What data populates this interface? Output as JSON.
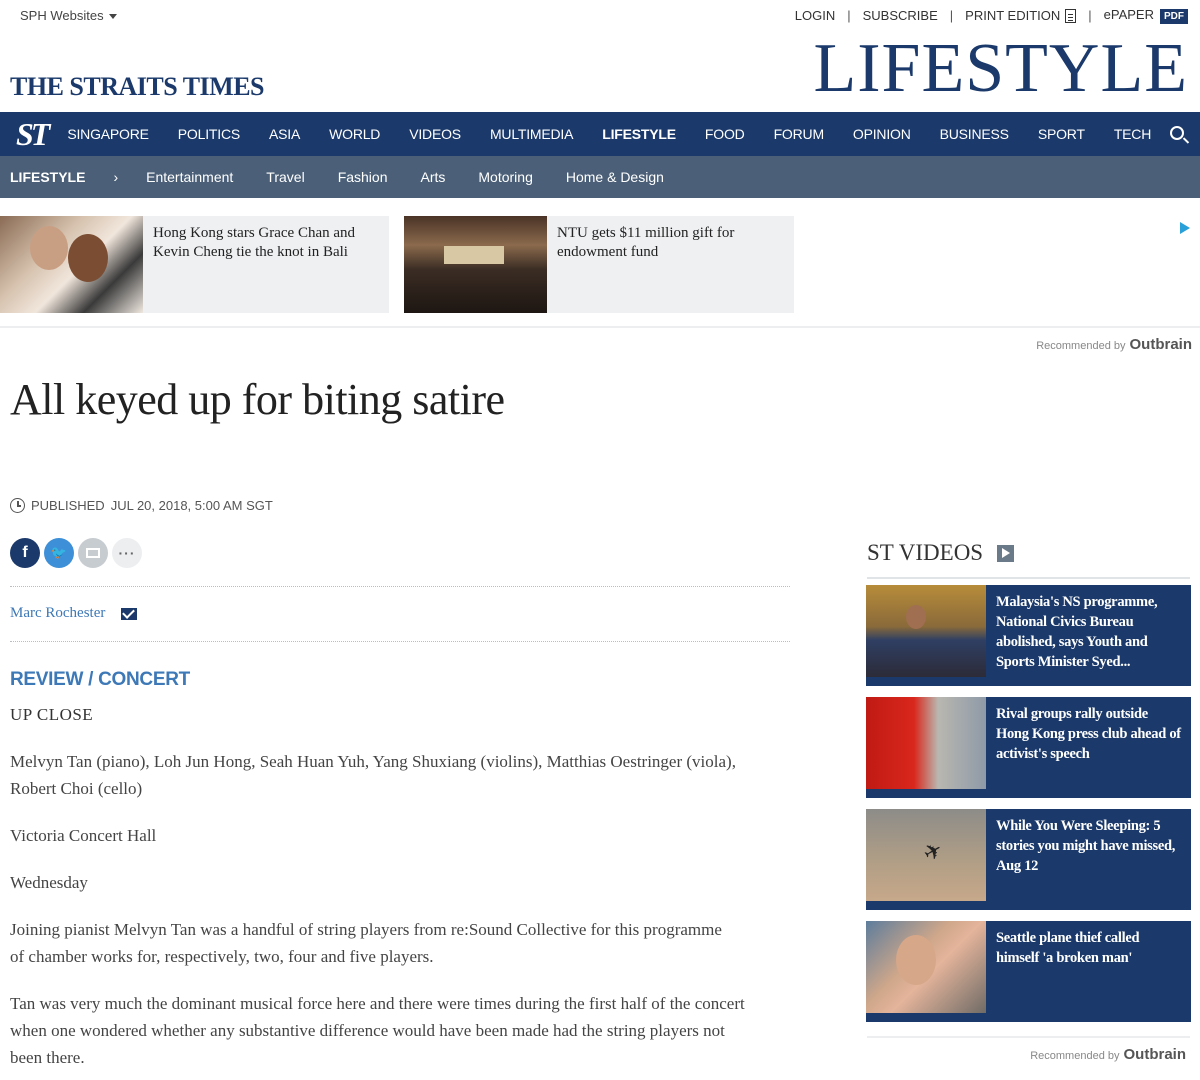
{
  "util": {
    "sph_websites": "SPH Websites",
    "links": [
      "LOGIN",
      "SUBSCRIBE",
      "PRINT EDITION",
      "ePAPER"
    ],
    "pdf_badge": "PDF"
  },
  "masthead": {
    "logo": "THE STRAITS TIMES",
    "section_title": "LIFESTYLE"
  },
  "nav": {
    "mark": "ST",
    "items": [
      "SINGAPORE",
      "POLITICS",
      "ASIA",
      "WORLD",
      "VIDEOS",
      "MULTIMEDIA",
      "LIFESTYLE",
      "FOOD",
      "FORUM",
      "OPINION",
      "BUSINESS",
      "SPORT",
      "TECH"
    ],
    "active": "LIFESTYLE"
  },
  "subnav": {
    "root": "LIFESTYLE",
    "items": [
      "Entertainment",
      "Travel",
      "Fashion",
      "Arts",
      "Motoring",
      "Home & Design"
    ]
  },
  "recommended": {
    "cards": [
      {
        "title": "Hong Kong stars Grace Chan and Kevin Cheng tie the knot in Bali"
      },
      {
        "title": "NTU gets $11 million gift for endowment fund"
      }
    ],
    "by_label": "Recommended by",
    "brand": "Outbrain"
  },
  "article": {
    "headline": "All keyed up for biting satire",
    "published_label": "PUBLISHED",
    "published_date": "JUL 20, 2018, 5:00 AM SGT",
    "author": "Marc Rochester",
    "kicker": "REVIEW / CONCERT",
    "subhead": "UP CLOSE",
    "paragraphs": [
      "Melvyn Tan (piano), Loh Jun Hong, Seah Huan Yuh, Yang Shuxiang (violins), Matthias Oestringer (viola), Robert Choi (cello)",
      "Victoria Concert Hall",
      "Wednesday",
      "Joining pianist Melvyn Tan was a handful of string players from re:Sound Collective for this programme of chamber works for, respectively, two, four and five players.",
      "Tan was very much the dominant musical force here and there were times during the first half of the concert when one wondered whether any substantive difference would have been made had the string players not been there."
    ]
  },
  "rail": {
    "title": "ST VIDEOS",
    "videos": [
      {
        "title": "Malaysia's NS programme, National Civics Bureau abolished, says Youth and Sports Minister Syed..."
      },
      {
        "title": "Rival groups rally outside Hong Kong press club ahead of activist's speech"
      },
      {
        "title": "While You Were Sleeping: 5 stories you might have missed, Aug 12"
      },
      {
        "title": "Seattle plane thief called himself 'a broken man'"
      }
    ],
    "by_label": "Recommended by",
    "brand": "Outbrain"
  },
  "colors": {
    "brand_navy": "#1b3a6b",
    "subnav": "#4b6078",
    "link_blue": "#3d78b7"
  }
}
